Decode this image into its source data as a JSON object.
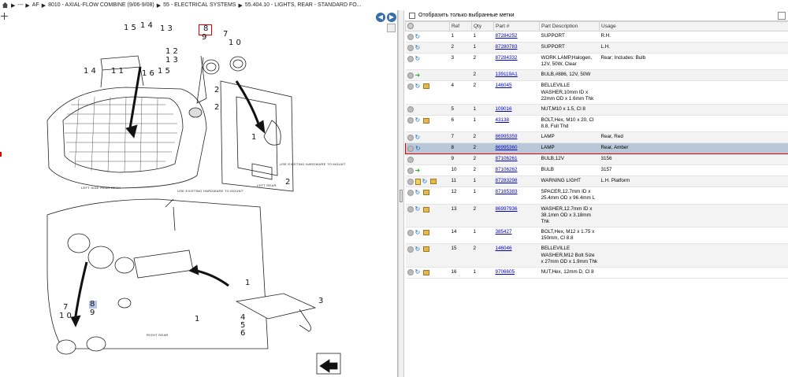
{
  "breadcrumb": [
    "---",
    "AF",
    "8010 - AXIAL-FLOW COMBINE (9/06-9/08)",
    "55 - ELECTRICAL SYSTEMS",
    "55.404.10 - LIGHTS, REAR - STANDARD FO..."
  ],
  "diagram": {
    "labels": {
      "left_side_rear_deck": "LEFT SIDE REAR DECK",
      "left_rear": "LEFT REAR",
      "right_rear": "RIGHT REAR",
      "use_existing_1": "USE EXISTING HARDWARE TO MOUNT",
      "use_existing_2": "USE EXISTING HARDWARE TO MOUNT"
    },
    "callouts": {
      "c15": "1 5",
      "c14": "1 4",
      "c13": "1 3",
      "c12": "1 2",
      "c13b": "1 3",
      "c11": "1 1",
      "c16": "1 6",
      "c15b": "1 5",
      "c14b": "1 4",
      "c8": "8",
      "c9": "9",
      "c7": "7",
      "c10": "1 0",
      "c2a": "2",
      "c2b": "2",
      "c2c": "2",
      "c1a": "1",
      "c7b": "7",
      "c10b": "1 0",
      "c8b": "8",
      "c9b": "9",
      "c1b": "1",
      "c1c": "1",
      "c3": "3",
      "c4": "4",
      "c5": "5",
      "c6": "6"
    }
  },
  "filter": {
    "label": "Отобразить только выбранные метки",
    "checked": false
  },
  "table": {
    "columns": [
      "",
      "Ref",
      "Qty",
      "Part #",
      "Part Description",
      "Usage"
    ],
    "rows": [
      {
        "icons": [
          "remove",
          "refresh"
        ],
        "ref": "1",
        "qty": "1",
        "part": "87284252",
        "desc": "SUPPORT",
        "usage": "R.H."
      },
      {
        "icons": [
          "remove",
          "refresh"
        ],
        "ref": "2",
        "qty": "1",
        "part": "87280783",
        "desc": "SUPPORT",
        "usage": "L.H."
      },
      {
        "icons": [
          "remove",
          "refresh"
        ],
        "ref": "3",
        "qty": "2",
        "part": "87284332",
        "desc": "WORK LAMP,Halogen, 12V, 50W, Clear",
        "usage": "Rear; Includes: Bulb"
      },
      {
        "icons": [
          "remove",
          "arrow"
        ],
        "ref": "",
        "qty": "2",
        "part": "139119A1",
        "desc": "BULB,#886, 12V, 50W",
        "usage": ""
      },
      {
        "icons": [
          "remove",
          "refresh",
          "box"
        ],
        "ref": "4",
        "qty": "2",
        "part": "146045",
        "desc": "BELLEVILLE WASHER,10mm ID x 22mm OD x 1.6mm Thk",
        "usage": ""
      },
      {
        "icons": [
          "remove"
        ],
        "ref": "5",
        "qty": "1",
        "part": "109016",
        "desc": "NUT,M10 x 1.5, Cl 8",
        "usage": ""
      },
      {
        "icons": [
          "remove",
          "refresh",
          "box"
        ],
        "ref": "6",
        "qty": "1",
        "part": "43138",
        "desc": "BOLT,Hex, M10 x 20, Cl 8.8, Full Thd",
        "usage": ""
      },
      {
        "icons": [
          "remove",
          "refresh"
        ],
        "ref": "7",
        "qty": "2",
        "part": "86995359",
        "desc": "LAMP",
        "usage": "Rear, Red"
      },
      {
        "icons": [
          "remove",
          "refresh"
        ],
        "ref": "8",
        "qty": "2",
        "part": "86995360",
        "desc": "LAMP",
        "usage": "Rear, Amber",
        "selected": true
      },
      {
        "icons": [
          "remove"
        ],
        "ref": "9",
        "qty": "2",
        "part": "87106261",
        "desc": "BULB,12V",
        "usage": "3156"
      },
      {
        "icons": [
          "remove",
          "arrow"
        ],
        "ref": "10",
        "qty": "2",
        "part": "87106262",
        "desc": "BULB",
        "usage": "3157"
      },
      {
        "icons": [
          "remove",
          "doc",
          "refresh",
          "box"
        ],
        "ref": "11",
        "qty": "1",
        "part": "87283298",
        "desc": "WARNING LIGHT",
        "usage": "L.H. Platform"
      },
      {
        "icons": [
          "remove",
          "refresh",
          "box"
        ],
        "ref": "12",
        "qty": "1",
        "part": "87165383",
        "desc": "SPACER,12.7mm ID x 25.4mm OD x 96.4mm L",
        "usage": ""
      },
      {
        "icons": [
          "remove",
          "refresh",
          "box"
        ],
        "ref": "13",
        "qty": "2",
        "part": "86997936",
        "desc": "WASHER,12.7mm ID x 38.1mm OD x 3.18mm Thk",
        "usage": ""
      },
      {
        "icons": [
          "remove",
          "refresh",
          "box"
        ],
        "ref": "14",
        "qty": "1",
        "part": "385427",
        "desc": "BOLT,Hex, M12 x 1.75 x 150mm, Cl 8.8",
        "usage": ""
      },
      {
        "icons": [
          "remove",
          "refresh",
          "box"
        ],
        "ref": "15",
        "qty": "2",
        "part": "146046",
        "desc": "BELLEVILLE WASHER,M12 Bolt Size x 27mm OD x 1.9mm Thk",
        "usage": ""
      },
      {
        "icons": [
          "remove",
          "refresh",
          "box"
        ],
        "ref": "16",
        "qty": "1",
        "part": "9706605",
        "desc": "NUT,Hex, 12mm D, Cl 8",
        "usage": ""
      }
    ]
  }
}
